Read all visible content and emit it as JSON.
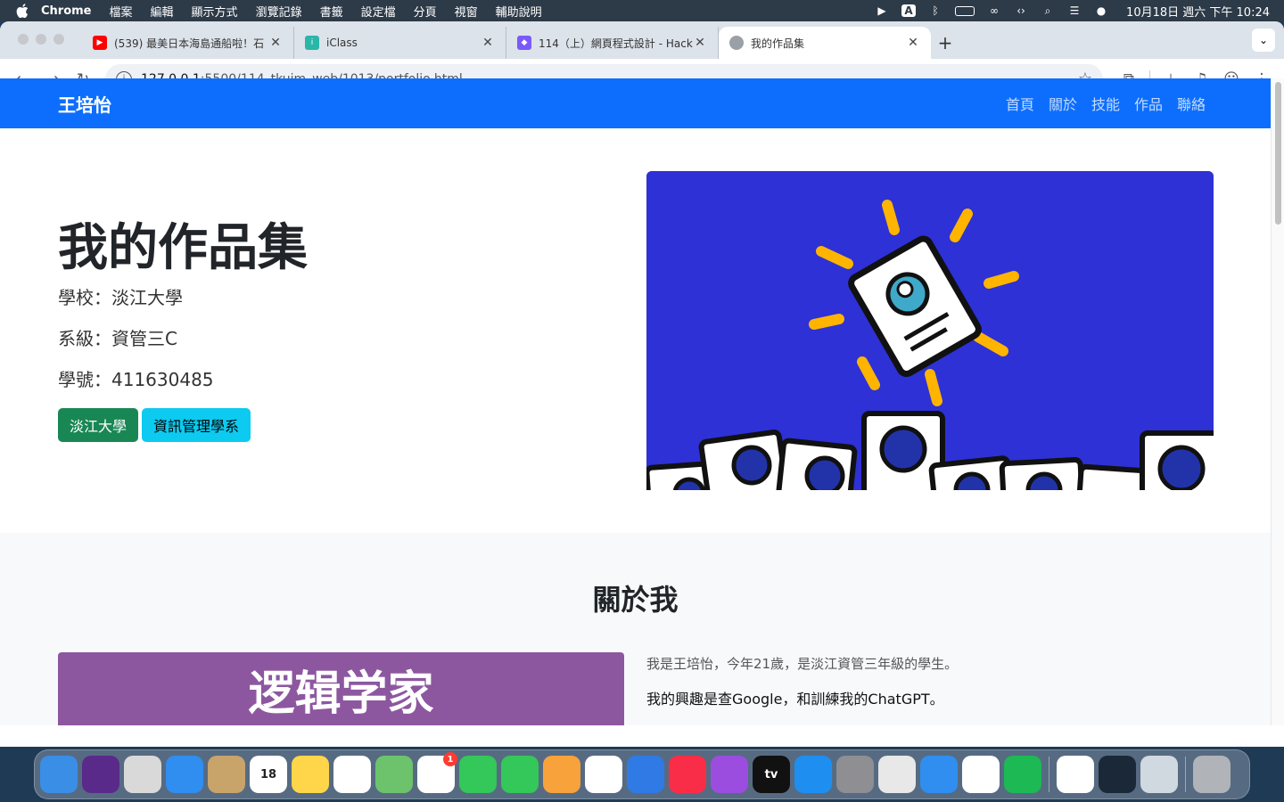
{
  "menubar": {
    "app": "Chrome",
    "items": [
      "檔案",
      "編輯",
      "顯示方式",
      "瀏覽記錄",
      "書籤",
      "設定檔",
      "分頁",
      "視窗",
      "輔助說明"
    ],
    "clock": "10月18日 週六 下午 10:24",
    "status_icons": [
      "play-circle-icon",
      "input-method-icon",
      "bluetooth-icon",
      "battery-icon",
      "link-icon",
      "code-icon",
      "search-icon",
      "control-center-icon",
      "siri-icon"
    ],
    "input_method_label": "A"
  },
  "tabs": [
    {
      "title": "(539) 最美日本海島通船啦！石",
      "favicon_color": "#ff0000",
      "active": false
    },
    {
      "title": "iClass",
      "favicon_color": "#2ab6a8",
      "active": false
    },
    {
      "title": "114（上）網頁程式設計 - Hack",
      "favicon_color": "#7a5af8",
      "active": false
    },
    {
      "title": "我的作品集",
      "favicon_color": "#9aa0a6",
      "active": true
    }
  ],
  "address": {
    "host": "127.0.0.1",
    "path": ":5500/114_tkuim_web/1013/portfolio.html"
  },
  "page": {
    "brand": "王培怡",
    "nav": [
      "首頁",
      "關於",
      "技能",
      "作品",
      "聯絡"
    ],
    "hero": {
      "title": "我的作品集",
      "school": "學校：淡江大學",
      "dept": "系級：資管三C",
      "student_id": "學號：411630485",
      "btn1": "淡江大學",
      "btn2": "資訊管理學系"
    },
    "about": {
      "heading": "關於我",
      "image_text": "逻辑学家",
      "line1": "我是王培怡，今年21歲，是淡江資管三年級的學生。",
      "line2": "我的興趣是查Google，和訓練我的ChatGPT。"
    }
  },
  "dock": {
    "apps": [
      {
        "name": "finder",
        "color": "#3a8ee6",
        "label": ""
      },
      {
        "name": "siri",
        "color": "#5a2a8a",
        "label": ""
      },
      {
        "name": "launchpad",
        "color": "#d9d9d9",
        "label": ""
      },
      {
        "name": "mail",
        "color": "#2f8ef0",
        "label": ""
      },
      {
        "name": "contacts",
        "color": "#c8a36a",
        "label": ""
      },
      {
        "name": "calendar",
        "color": "#ffffff",
        "label": "18"
      },
      {
        "name": "notes",
        "color": "#ffd54a",
        "label": ""
      },
      {
        "name": "reminders",
        "color": "#ffffff",
        "label": ""
      },
      {
        "name": "maps",
        "color": "#6cc36c",
        "label": ""
      },
      {
        "name": "photos",
        "color": "#ffffff",
        "label": "",
        "badge": "1"
      },
      {
        "name": "messages",
        "color": "#34c759",
        "label": ""
      },
      {
        "name": "facetime",
        "color": "#34c759",
        "label": ""
      },
      {
        "name": "pages",
        "color": "#f7a23b",
        "label": ""
      },
      {
        "name": "numbers",
        "color": "#ffffff",
        "label": ""
      },
      {
        "name": "keynote",
        "color": "#2f7ae5",
        "label": ""
      },
      {
        "name": "music",
        "color": "#fa2d48",
        "label": ""
      },
      {
        "name": "podcasts",
        "color": "#9b4de0",
        "label": ""
      },
      {
        "name": "apple-tv",
        "color": "#111111",
        "label": "tv"
      },
      {
        "name": "app-store",
        "color": "#1f8ef1",
        "label": ""
      },
      {
        "name": "system-settings",
        "color": "#8e8e93",
        "label": ""
      },
      {
        "name": "cube-app",
        "color": "#e8e8e8",
        "label": ""
      },
      {
        "name": "safari",
        "color": "#2f8ef0",
        "label": ""
      },
      {
        "name": "vscode",
        "color": "#ffffff",
        "label": ""
      },
      {
        "name": "spotify",
        "color": "#1db954",
        "label": ""
      },
      {
        "name": "chrome",
        "color": "#ffffff",
        "label": ""
      },
      {
        "name": "steam",
        "color": "#1b2838",
        "label": ""
      },
      {
        "name": "preview",
        "color": "#d0d8e0",
        "label": ""
      },
      {
        "name": "trash",
        "color": "#b0b4b8",
        "label": ""
      }
    ]
  },
  "colors": {
    "navbar": "#0d6efd",
    "btn_green": "#198754",
    "btn_cyan": "#0dcaf0",
    "hero_image_bg": "#2e31d6",
    "about_image_bg": "#8d57a0"
  }
}
